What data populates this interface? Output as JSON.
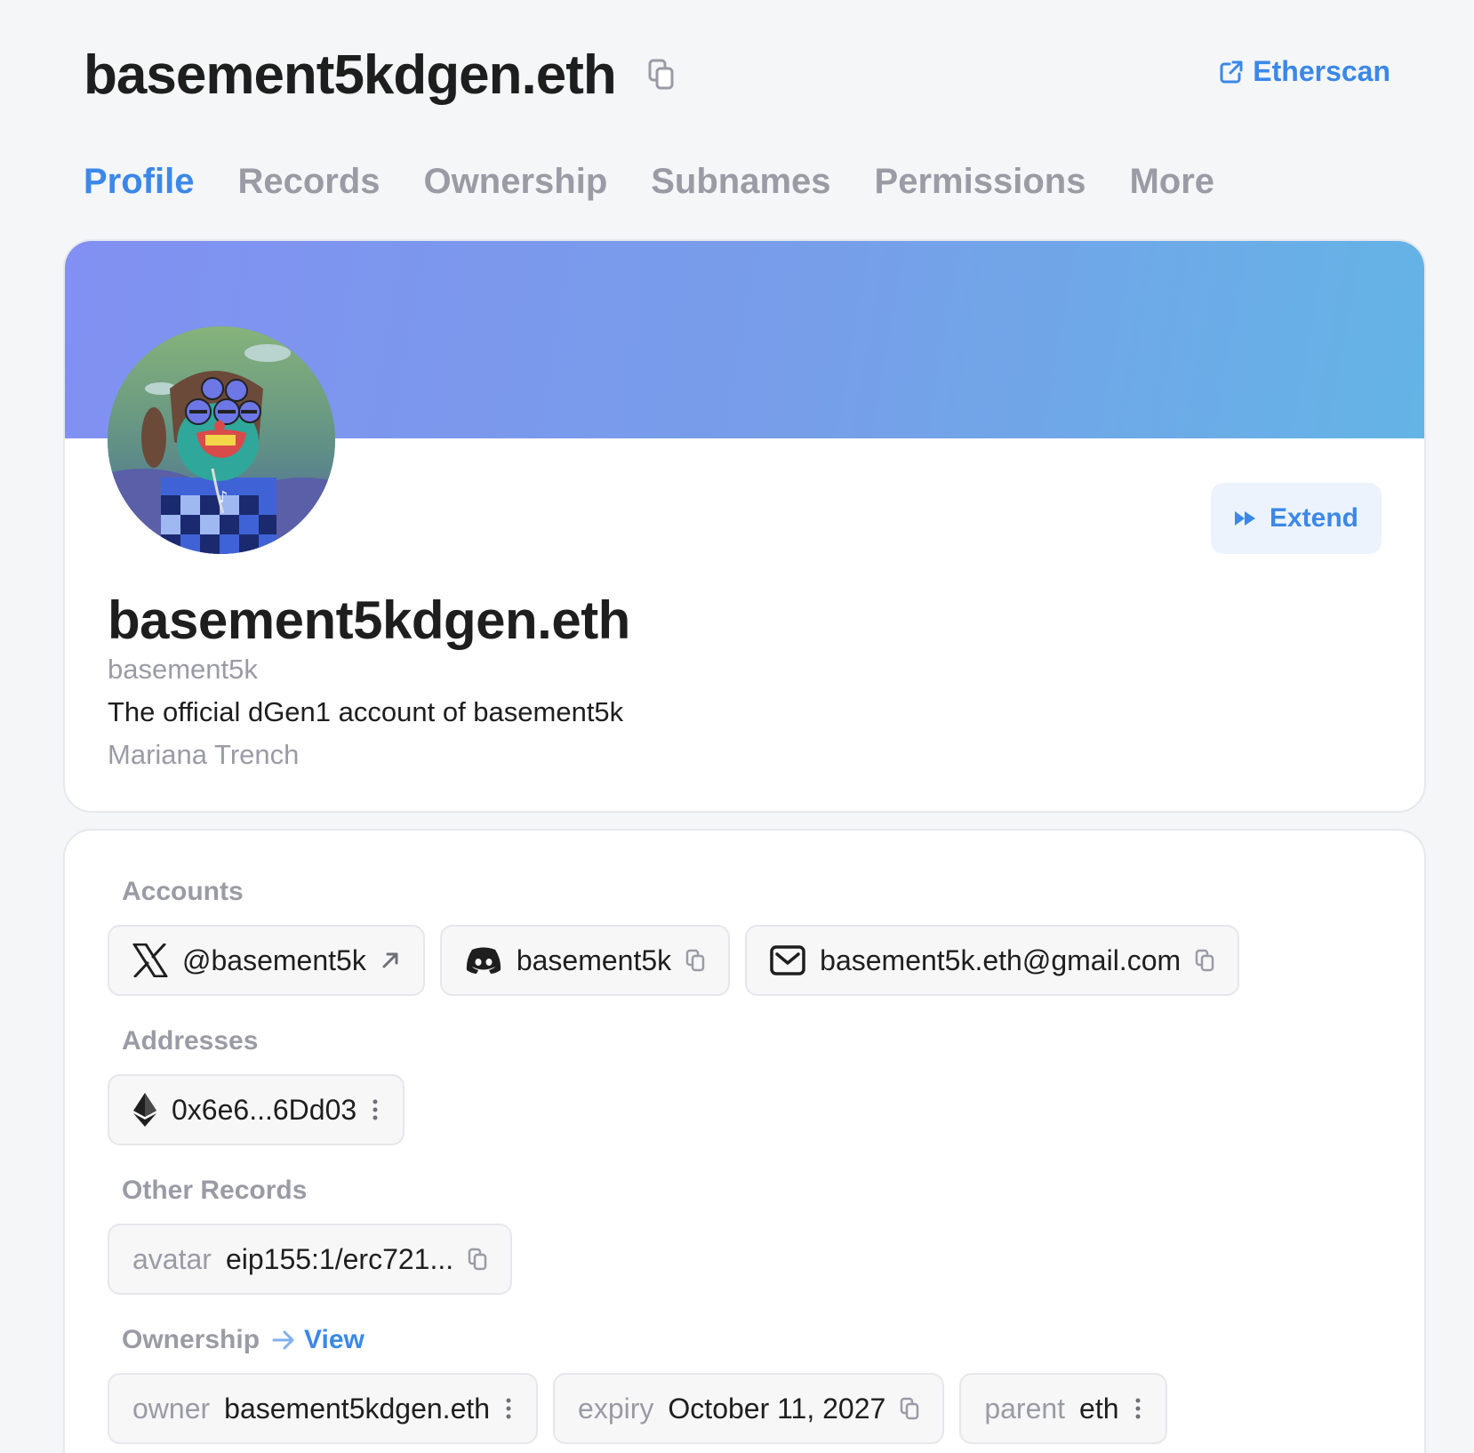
{
  "header": {
    "title": "basement5kdgen.eth",
    "etherscan_label": "Etherscan"
  },
  "tabs": [
    {
      "label": "Profile",
      "active": true
    },
    {
      "label": "Records"
    },
    {
      "label": "Ownership"
    },
    {
      "label": "Subnames"
    },
    {
      "label": "Permissions"
    },
    {
      "label": "More"
    }
  ],
  "profile": {
    "name": "basement5kdgen.eth",
    "username": "basement5k",
    "description": "The official dGen1 account of basement5k",
    "location": "Mariana Trench",
    "extend_label": "Extend"
  },
  "records": {
    "accounts_label": "Accounts",
    "accounts": [
      {
        "icon": "x-twitter-icon",
        "value": "@basement5k"
      },
      {
        "icon": "discord-icon",
        "value": "basement5k"
      },
      {
        "icon": "email-icon",
        "value": "basement5k.eth@gmail.com"
      }
    ],
    "addresses_label": "Addresses",
    "addresses": [
      {
        "icon": "ethereum-icon",
        "value": "0x6e6...6Dd03"
      }
    ],
    "other_label": "Other Records",
    "other": [
      {
        "key": "avatar",
        "value": "eip155:1/erc721..."
      }
    ],
    "ownership_label": "Ownership",
    "view_label": "View",
    "ownership": [
      {
        "key": "owner",
        "value": "basement5kdgen.eth"
      },
      {
        "key": "expiry",
        "value": "October 11, 2027"
      },
      {
        "key": "parent",
        "value": "eth"
      }
    ]
  },
  "colors": {
    "accent": "#3b88e8",
    "muted": "#9b9ba5",
    "text": "#1e1e1e",
    "banner_start": "#8190f2",
    "banner_end": "#64b4e6"
  }
}
